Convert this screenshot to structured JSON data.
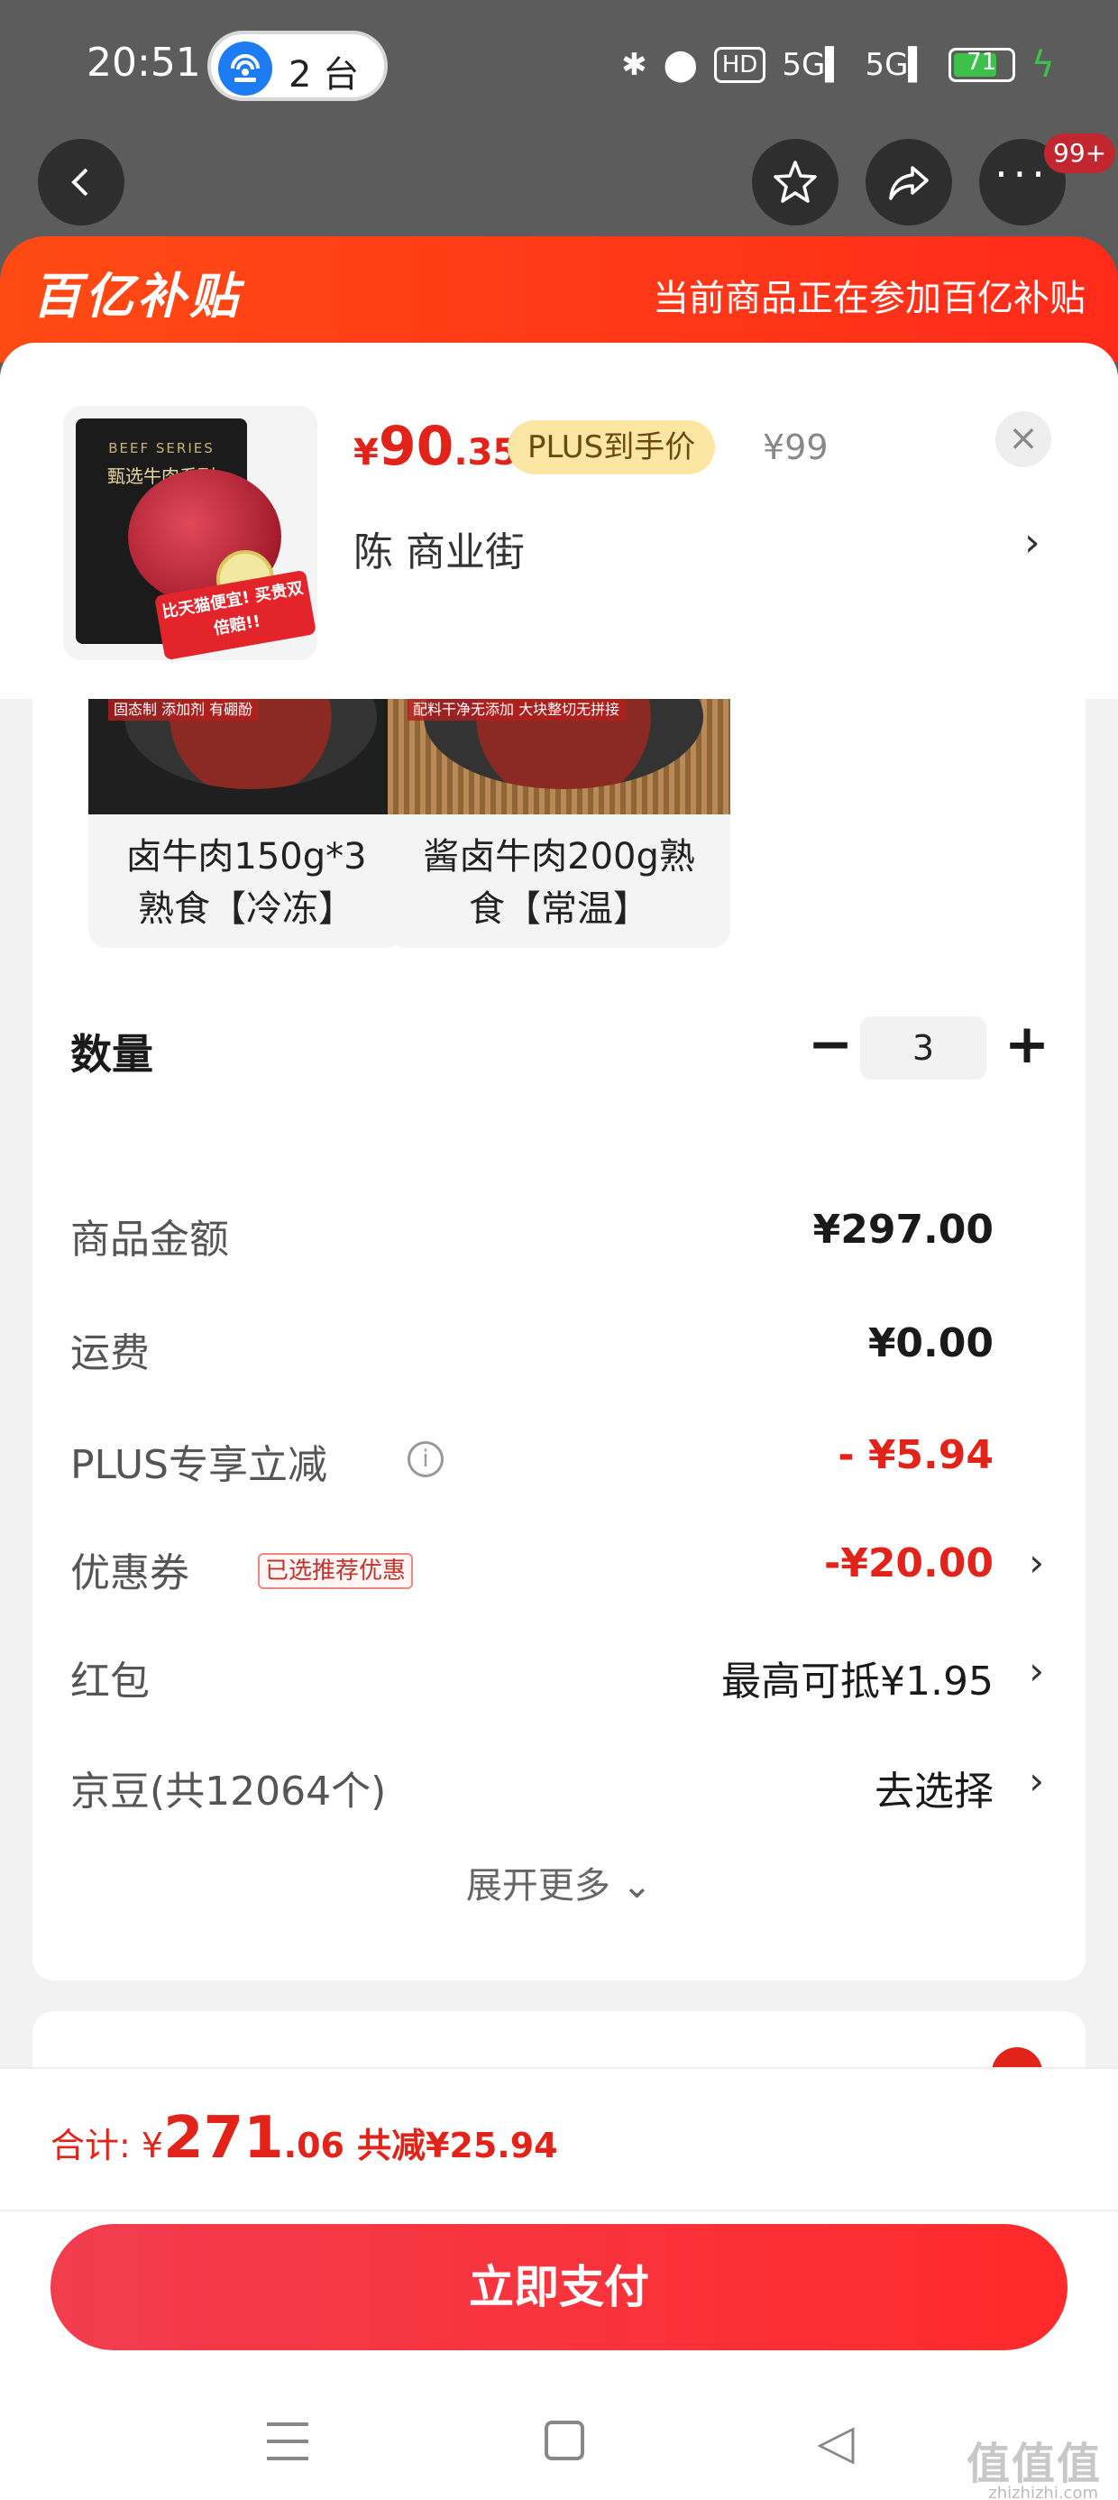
{
  "status_bar": {
    "time": "20:51",
    "hotspot_count": "2 台",
    "battery": "71",
    "network_label": "HD",
    "signal_label_1": "5G",
    "signal_label_2": "5G"
  },
  "top_nav": {
    "back_icon": "back-arrow-icon",
    "favorite_icon": "star-icon",
    "share_icon": "share-icon",
    "more_icon": "more-icon",
    "badge": "99+"
  },
  "banner": {
    "logo": "百亿补贴",
    "text": "当前商品正在参加百亿补贴"
  },
  "product": {
    "price_currency": "¥",
    "price_int": "90",
    "price_dec": ".35",
    "plus_tag": "PLUS到手价",
    "original_price": "¥99",
    "address": "陈  商业街",
    "image_series": "BEEF SERIES",
    "image_name": "甄选牛肉系列",
    "image_sticker": "比天猫便宜! 买贵双倍赔!!"
  },
  "variants": [
    {
      "line1": "卤牛肉150g*3",
      "line2": "熟食【冷冻】",
      "img_tag": "固态制 添加剂 有硼酚"
    },
    {
      "line1": "酱卤牛肉200g熟",
      "line2": "食【常温】",
      "img_tag": "配料干净无添加 大块整切无拼接"
    }
  ],
  "quantity": {
    "label": "数量",
    "value": "3",
    "minus": "−",
    "plus": "+"
  },
  "cost": {
    "goods_label": "商品金额",
    "goods_value": "¥297.00",
    "shipping_label": "运费",
    "shipping_value": "¥0.00",
    "plus_label": "PLUS专享立减",
    "plus_value": "- ¥5.94",
    "coupon_label": "优惠券",
    "coupon_tag": "已选推荐优惠",
    "coupon_value": "-¥20.00",
    "redpacket_label": "红包",
    "redpacket_value": "最高可抵¥1.95",
    "jd_label": "京豆(共12064个)",
    "jd_value": "去选择",
    "expand": "展开更多 ⌄"
  },
  "checkout": {
    "total_label": "合计: ¥",
    "total_int": "271",
    "total_dec": ".06",
    "saved": "共减¥25.94",
    "pay_button": "立即支付"
  },
  "watermark": {
    "text": "值值值",
    "sub": "zhizhizhi.com"
  },
  "colors": {
    "accent_red": "#e2231a",
    "banner_orange": "#ff4a14",
    "plus_gold": "#fce6a4"
  }
}
